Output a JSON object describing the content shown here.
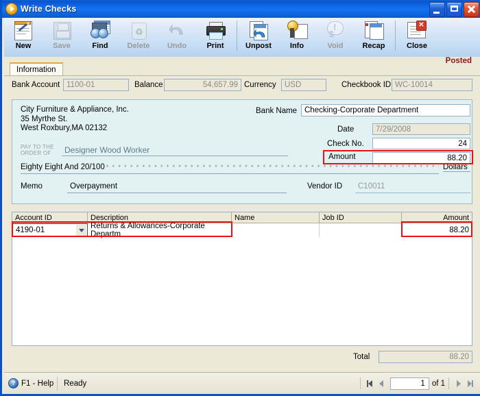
{
  "window": {
    "title": "Write Checks",
    "app_icon": "play-circle-icon",
    "minimize_label": "Minimize",
    "maximize_label": "Maximize",
    "close_label": "Close"
  },
  "toolbar": {
    "buttons": [
      {
        "label": "New",
        "icon": "new-document-icon",
        "enabled": true
      },
      {
        "label": "Save",
        "icon": "floppy-disk-icon",
        "enabled": false
      },
      {
        "label": "Find",
        "icon": "binoculars-icon",
        "enabled": true
      },
      {
        "label": "Delete",
        "icon": "recycle-bin-icon",
        "enabled": false
      },
      {
        "label": "Undo",
        "icon": "undo-arrow-icon",
        "enabled": false
      },
      {
        "label": "Print",
        "icon": "printer-icon",
        "enabled": true
      },
      {
        "label": "Unpost",
        "icon": "unpost-icon",
        "enabled": true
      },
      {
        "label": "Info",
        "icon": "info-seal-icon",
        "enabled": true
      },
      {
        "label": "Void",
        "icon": "void-icon",
        "enabled": false
      },
      {
        "label": "Recap",
        "icon": "recap-icon",
        "enabled": true
      },
      {
        "label": "Close",
        "icon": "close-document-icon",
        "enabled": true
      }
    ]
  },
  "tabs": [
    {
      "label": "Information",
      "active": true
    }
  ],
  "status_badge": {
    "text": "Posted",
    "color": "#8b1a1a"
  },
  "header_fields": {
    "bank_account_label": "Bank Account",
    "bank_account_value": "1100-01",
    "balance_label": "Balance",
    "balance_value": "54,657.99",
    "currency_label": "Currency",
    "currency_value": "USD",
    "checkbook_label": "Checkbook ID",
    "checkbook_value": "WC-10014"
  },
  "check": {
    "payor_line1": "City Furniture & Appliance, Inc.",
    "payor_line2": "35 Myrthe St.",
    "payor_line3": "West Roxbury,MA 02132",
    "pay_to_label_line1": "PAY TO THE",
    "pay_to_label_line2": "ORDER OF",
    "payee_value": "Designer Wood Worker",
    "amount_words": "Eighty Eight And 20/100",
    "amount_stars": "* * * * * * * * * * * * * * * * * * * * * * * * * * * * * * * * * * * * * * * * * * * * * * * * * * * * * * * * * * * * * * * * * *",
    "dollars_label": "Dollars",
    "memo_label": "Memo",
    "memo_value": "Overpayment",
    "vendor_label": "Vendor ID",
    "vendor_value": "C10011",
    "bank_name_label": "Bank Name",
    "bank_name_value": "Checking-Corporate Department",
    "date_label": "Date",
    "date_value": "7/29/2008",
    "check_no_label": "Check No.",
    "check_no_value": "24",
    "amount_label": "Amount",
    "amount_value": "88.20",
    "amount_highlight_color": "#ee1111"
  },
  "grid": {
    "columns": [
      {
        "key": "account_id",
        "label": "Account ID"
      },
      {
        "key": "description",
        "label": "Description"
      },
      {
        "key": "name",
        "label": "Name"
      },
      {
        "key": "job_id",
        "label": "Job ID"
      },
      {
        "key": "amount",
        "label": "Amount"
      }
    ],
    "rows": [
      {
        "account_id": "4190-01",
        "description": "Returns & Allowances-Corporate Departm",
        "name": "",
        "job_id": "",
        "amount": "88.20"
      }
    ],
    "dropdown_icon": "chevron-down-icon"
  },
  "total": {
    "label": "Total",
    "value": "88.20"
  },
  "statusbar": {
    "help_icon": "question-mark-icon",
    "help_label": "F1 - Help",
    "status_text": "Ready",
    "first_label": "First record",
    "prev_label": "Previous record",
    "next_label": "Next record",
    "last_label": "Last record",
    "page_value": "1",
    "page_of": "of  1"
  }
}
